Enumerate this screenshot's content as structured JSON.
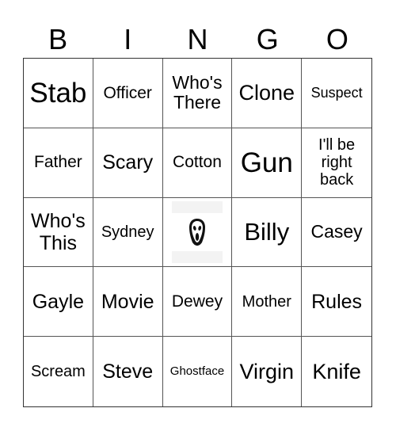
{
  "header": {
    "letters": [
      "B",
      "I",
      "N",
      "G",
      "O"
    ]
  },
  "cells": [
    {
      "text": "Stab",
      "size": "s36"
    },
    {
      "text": "Officer",
      "size": "s22"
    },
    {
      "text": "Who's There",
      "size": "s24"
    },
    {
      "text": "Clone",
      "size": "s28"
    },
    {
      "text": "Suspect",
      "size": "s18"
    },
    {
      "text": "Father",
      "size": "s22"
    },
    {
      "text": "Scary",
      "size": "s26"
    },
    {
      "text": "Cotton",
      "size": "s22"
    },
    {
      "text": "Gun",
      "size": "s36"
    },
    {
      "text": "I'll be right back",
      "size": "s20"
    },
    {
      "text": "Who's This",
      "size": "s26"
    },
    {
      "text": "Sydney",
      "size": "s20"
    },
    {
      "free": true,
      "icon": "ghostface-mask-icon"
    },
    {
      "text": "Billy",
      "size": "s32"
    },
    {
      "text": "Casey",
      "size": "s24"
    },
    {
      "text": "Gayle",
      "size": "s26"
    },
    {
      "text": "Movie",
      "size": "s26"
    },
    {
      "text": "Dewey",
      "size": "s22"
    },
    {
      "text": "Mother",
      "size": "s20"
    },
    {
      "text": "Rules",
      "size": "s26"
    },
    {
      "text": "Scream",
      "size": "s20"
    },
    {
      "text": "Steve",
      "size": "s26"
    },
    {
      "text": "Ghostface",
      "size": "s15"
    },
    {
      "text": "Virgin",
      "size": "s28"
    },
    {
      "text": "Knife",
      "size": "s28"
    }
  ]
}
